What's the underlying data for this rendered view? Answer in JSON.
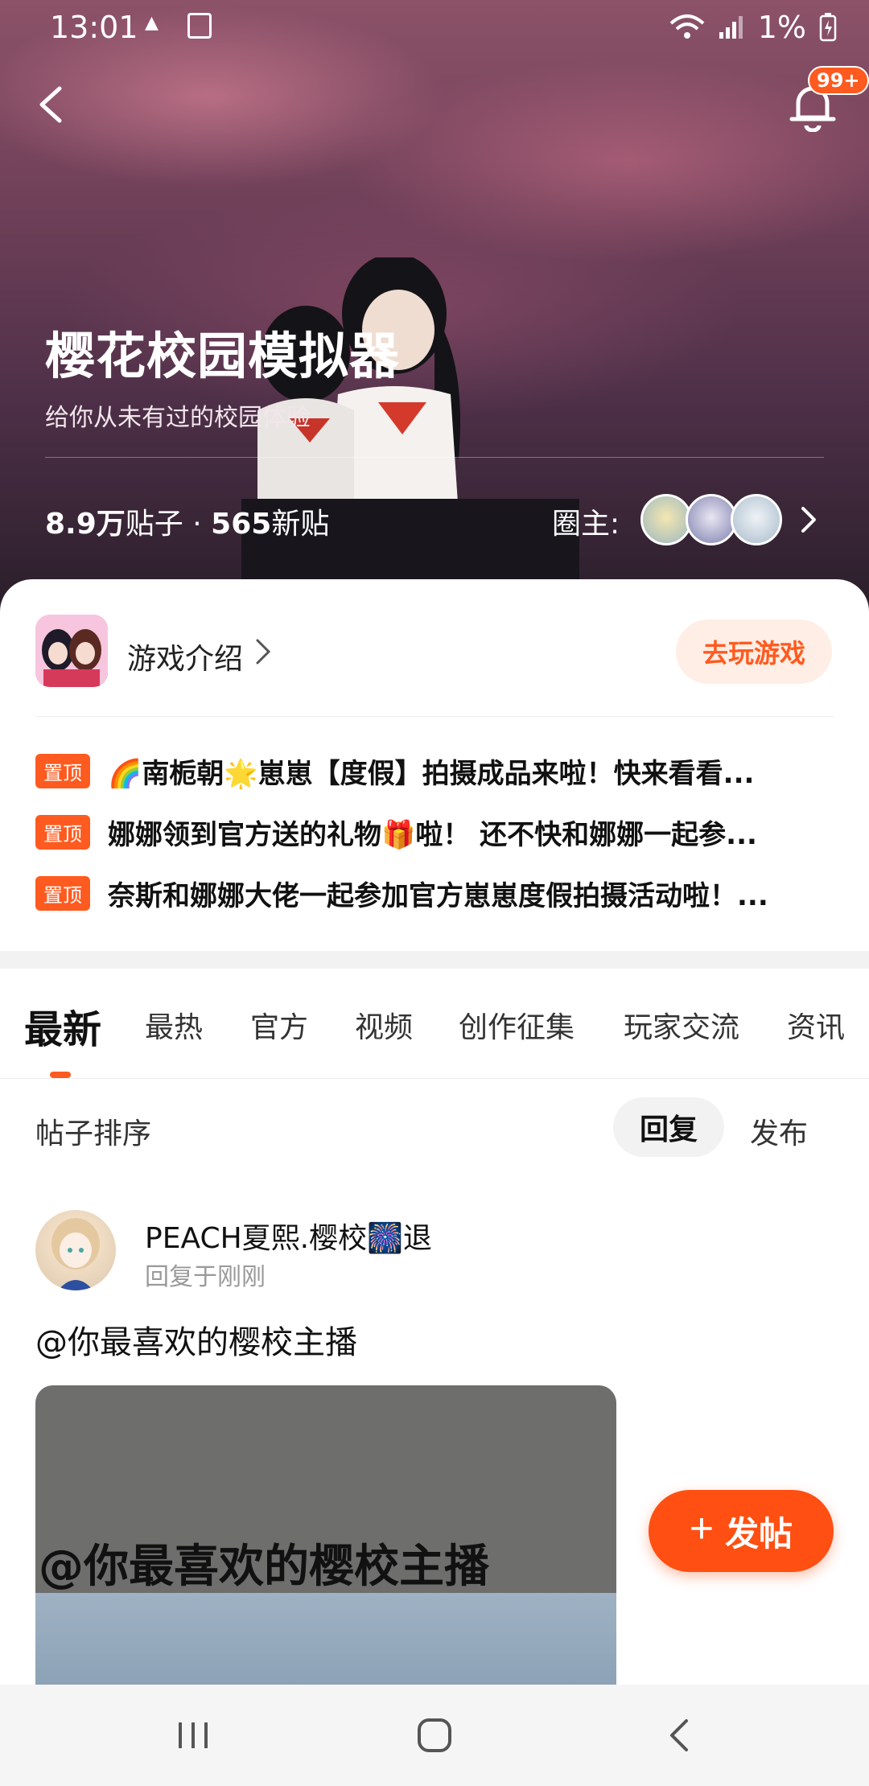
{
  "status_bar": {
    "time": "13:01",
    "battery": "1%",
    "icons": [
      "mm-icon",
      "clock-icon",
      "wifi-icon",
      "signal-icon",
      "battery-icon"
    ]
  },
  "header": {
    "notification_badge": "99+"
  },
  "community": {
    "title": "樱花校园模拟器",
    "subtitle": "给你从未有过的校园体验",
    "posts_count": "8.9万",
    "posts_label": "贴子",
    "dot": "·",
    "new_count": "565",
    "new_label": "新贴",
    "owner_label": "圈主:"
  },
  "game": {
    "intro_label": "游戏介绍",
    "play_button": "去玩游戏"
  },
  "pinned": [
    {
      "tag": "置顶",
      "text": "🌈南栀朝🌟崽崽【度假】拍摄成品来啦！快来看看..."
    },
    {
      "tag": "置顶",
      "text": "娜娜领到官方送的礼物🎁啦！ 还不快和娜娜一起参..."
    },
    {
      "tag": "置顶",
      "text": "奈斯和娜娜大佬一起参加官方崽崽度假拍摄活动啦！..."
    }
  ],
  "tabs": [
    "最新",
    "最热",
    "官方",
    "视频",
    "创作征集",
    "玩家交流",
    "资讯"
  ],
  "sort": {
    "label": "帖子排序",
    "reply": "回复",
    "post": "发布"
  },
  "post": {
    "username": "PEACH夏熙.樱校🎆退",
    "time": "回复于刚刚",
    "body": "@你最喜欢的樱校主播",
    "image_text": "@你最喜欢的樱校主播"
  },
  "fab": {
    "label": "发帖",
    "plus": "+"
  },
  "colors": {
    "accent": "#ff5a1f",
    "fab": "#ff4f12"
  }
}
